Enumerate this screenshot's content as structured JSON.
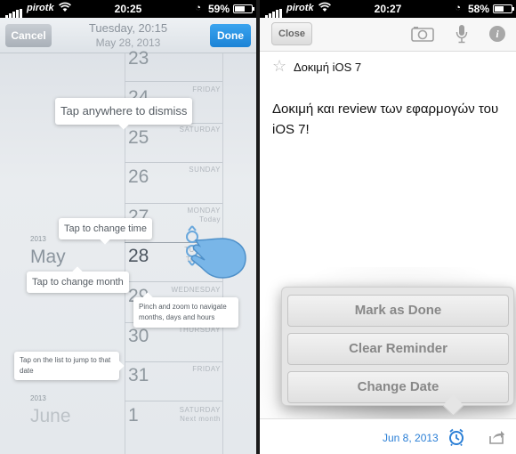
{
  "left": {
    "status": {
      "carrier": "pirotk",
      "time": "20:25",
      "battery": "59%",
      "battery_level": 0.59
    },
    "nav": {
      "cancel": "Cancel",
      "title": "Tuesday, 20:15",
      "subtitle": "May 28, 2013",
      "done": "Done"
    },
    "days": [
      {
        "num": "23",
        "name": ""
      },
      {
        "num": "24",
        "name": "FRIDAY"
      },
      {
        "num": "25",
        "name": "SATURDAY"
      },
      {
        "num": "26",
        "name": "SUNDAY"
      },
      {
        "num": "27",
        "name": "MONDAY",
        "sub": "Today"
      },
      {
        "num": "28",
        "name": "TUESDAY",
        "sub": "Tomorrow"
      },
      {
        "num": "29",
        "name": "WEDNESDAY"
      },
      {
        "num": "30",
        "name": "THURSDAY"
      },
      {
        "num": "31",
        "name": "FRIDAY"
      },
      {
        "num": "1",
        "name": "SATURDAY",
        "sub": "Next month"
      }
    ],
    "months": [
      {
        "year": "2013",
        "name": "May"
      },
      {
        "year": "2013",
        "name": "June"
      }
    ],
    "tips": {
      "dismiss": "Tap anywhere to dismiss",
      "change_time": "Tap to change time",
      "change_month": "Tap to change month",
      "pinch": "Pinch and zoom to navigate months, days and hours",
      "jump": "Tap on the list to jump to that date"
    }
  },
  "right": {
    "status": {
      "carrier": "pirotk",
      "time": "20:27",
      "battery": "58%",
      "battery_level": 0.58
    },
    "nav": {
      "close": "Close"
    },
    "note": {
      "title": "Δοκιμή iOS 7",
      "body": "Δοκιμή και review των εφαρμογών του iOS 7!"
    },
    "menu": {
      "mark_done": "Mark as Done",
      "clear": "Clear Reminder",
      "change_date": "Change Date"
    },
    "footer": {
      "date": "Jun 8, 2013"
    }
  },
  "colors": {
    "accent": "#1b83d6",
    "link": "#2b7fd6"
  },
  "icons": [
    "signal-icon",
    "wifi-icon",
    "lock-icon",
    "battery-icon",
    "camera-icon",
    "microphone-icon",
    "info-icon",
    "star-icon",
    "alarm-icon",
    "share-icon",
    "hand-gesture-icon"
  ]
}
